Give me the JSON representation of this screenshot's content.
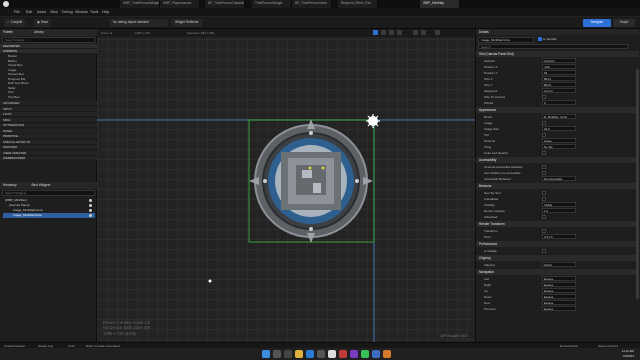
{
  "window": {
    "document_tabs": [
      {
        "label": "WBP_ThirdPersonWidget",
        "active": false
      },
      {
        "label": "WBP_Playersonuse",
        "active": false
      },
      {
        "label": "BP_ThirdPersonCharacter",
        "active": false
      },
      {
        "label": "ThirdPersonWidget",
        "active": false
      },
      {
        "label": "BP_ThirdPersonGame",
        "active": false
      },
      {
        "label": "Blueprint_Effect_Fire",
        "active": false
      },
      {
        "label": "WBP_MiniMap",
        "active": true
      }
    ]
  },
  "menubar": {
    "items": [
      "File",
      "Edit",
      "Asset",
      "View",
      "Debug",
      "Window",
      "Tools",
      "Help"
    ]
  },
  "toolbar": {
    "compile_label": "Compile",
    "save_label": "Save",
    "debug_filter": "No debug object selected",
    "widget_reflector": "Widget Reflector",
    "designer_label": "Designer",
    "graph_label": "Graph"
  },
  "palette": {
    "title": "Palette",
    "library_tab": "Library",
    "search_placeholder": "Search Palette",
    "categories": [
      {
        "label": "FAVORITES",
        "head": true
      },
      {
        "label": "COMMON",
        "head": true
      }
    ],
    "common_items": [
      "Border",
      "Button",
      "Check Box",
      "Image",
      "Named Slot",
      "Progress Bar",
      "Rich Text Block",
      "Slider",
      "Text",
      "Text Box"
    ],
    "more_categories": [
      "ADVANCED",
      "INPUT",
      "LISTS",
      "MISC",
      "OPTIMIZATION",
      "PANEL",
      "PRIMITIVE",
      "SPECIAL EFFECTS",
      "UNIFORM",
      "USER CREATED",
      "WEBBROWSER"
    ]
  },
  "hierarchy": {
    "title": "Hierarchy",
    "bind_widgets": "Bind Widgets",
    "search_placeholder": "Search Widgets",
    "rows": [
      {
        "label": "[WBP_MiniMap]",
        "indent": 0,
        "selected": false
      },
      {
        "label": "[Canvas Panel]",
        "indent": 1,
        "selected": false
      },
      {
        "label": "Image_MiniMapFrame",
        "indent": 2,
        "selected": false
      },
      {
        "label": "Image_MiniMapCircle",
        "indent": 2,
        "selected": true
      }
    ]
  },
  "canvas": {
    "zoom": "Zoom -2",
    "resolution": "1280 x 720",
    "selection": "Selection: 864 x 864",
    "screen_size": "1280 x 720 (16:9)",
    "scale_text": "Device Content Scale 1.0",
    "safe_zone": "No Device Safe Zone Set",
    "dpi": "DPI Scale 0.67"
  },
  "details": {
    "title": "Details",
    "widget_name": "Image_MiniMapCircle",
    "is_variable": "Is Variable",
    "search_placeholder": "Search",
    "sections": [
      {
        "label": "Slot (Canvas Panel Slot)",
        "rows": [
          {
            "label": "Anchors",
            "value": "Anchors"
          },
          {
            "label": "Position X",
            "value": "-426"
          },
          {
            "label": "Position Y",
            "value": "53"
          },
          {
            "label": "Size X",
            "value": "864.0"
          },
          {
            "label": "Size Y",
            "value": "864.0"
          },
          {
            "label": "Alignment",
            "value": "0.0   0.0"
          },
          {
            "label": "Size To Content",
            "value": ""
          },
          {
            "label": "ZOrder",
            "value": "0"
          }
        ]
      },
      {
        "label": "Appearance",
        "rows": [
          {
            "label": "Brush",
            "value": "M_MiniMap_Circle"
          },
          {
            "label": "Image",
            "value": ""
          },
          {
            "label": "Image Size",
            "value": "32.0"
          },
          {
            "label": "Tint",
            "value": ""
          },
          {
            "label": "Draw As",
            "value": "Image"
          },
          {
            "label": "Tiling",
            "value": "No Tile"
          },
          {
            "label": "Color and Opacity",
            "value": ""
          }
        ]
      },
      {
        "label": "Accessibility",
        "rows": [
          {
            "label": "Override Accessible Defaults",
            "value": ""
          },
          {
            "label": "Can Children be Accessible",
            "value": ""
          },
          {
            "label": "Accessible Behavior",
            "value": "Not Accessible"
          }
        ]
      },
      {
        "label": "Behavior",
        "rows": [
          {
            "label": "Tool Tip Text",
            "value": ""
          },
          {
            "label": "Is Enabled",
            "value": ""
          },
          {
            "label": "Visibility",
            "value": "Visible"
          },
          {
            "label": "Render Opacity",
            "value": "1.0"
          },
          {
            "label": "Advanced",
            "value": ""
          }
        ]
      },
      {
        "label": "Render Transform",
        "rows": [
          {
            "label": "Transform",
            "value": ""
          },
          {
            "label": "Pivot",
            "value": "0.5   0.5"
          }
        ]
      },
      {
        "label": "Performance",
        "rows": [
          {
            "label": "Is Volatile",
            "value": ""
          }
        ]
      },
      {
        "label": "Clipping",
        "rows": [
          {
            "label": "Clipping",
            "value": "Inherit"
          }
        ]
      },
      {
        "label": "Navigation",
        "rows": [
          {
            "label": "Left",
            "value": "Escape"
          },
          {
            "label": "Right",
            "value": "Escape"
          },
          {
            "label": "Up",
            "value": "Escape"
          },
          {
            "label": "Down",
            "value": "Escape"
          },
          {
            "label": "Next",
            "value": "Escape"
          },
          {
            "label": "Previous",
            "value": "Escape"
          }
        ]
      }
    ]
  },
  "status": {
    "items": [
      "Content Drawer",
      "Output Log",
      "Cmd",
      "Enter Console Command"
    ],
    "right": [
      "Derived Data",
      "Source Control"
    ]
  },
  "taskbar": {
    "time": "11:11 AM",
    "date": "7/5/2024"
  },
  "colors": {
    "accent": "#2d6fd8",
    "selection_green": "#3fbf3f",
    "guide_blue": "#4a8fd6"
  }
}
